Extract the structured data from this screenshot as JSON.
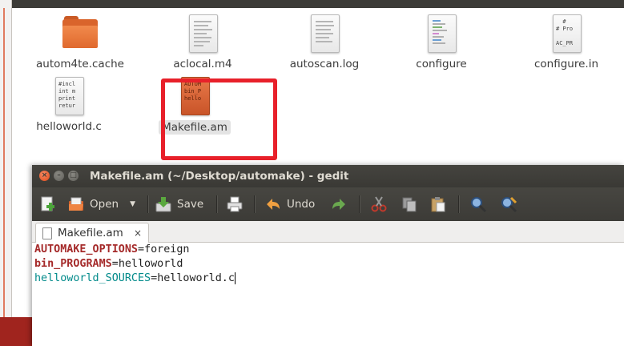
{
  "files": [
    {
      "name": "autom4te.cache",
      "icon": "folder-icon"
    },
    {
      "name": "aclocal.m4",
      "icon": "text-file-icon"
    },
    {
      "name": "autoscan.log",
      "icon": "text-file-icon"
    },
    {
      "name": "configure",
      "icon": "script-file-icon",
      "preview": "",
      "selected": false
    },
    {
      "name": "configure.in",
      "icon": "text-file-icon",
      "preview": "#\n# Pro\n\nAC_PR"
    },
    {
      "name": "helloworld.c",
      "icon": "c-source-icon",
      "preview": "#incl\nint m\nprint\nretur"
    },
    {
      "name": "Makefile.am",
      "icon": "makefile-icon",
      "preview": "AUTOM\nbin_P\nhello",
      "selected": true
    }
  ],
  "window": {
    "title": "Makefile.am (~/Desktop/automake) - gedit"
  },
  "toolbar": {
    "open_label": "Open",
    "save_label": "Save",
    "undo_label": "Undo"
  },
  "tab": {
    "label": "Makefile.am",
    "close": "×"
  },
  "editor": {
    "lines": [
      {
        "key": "AUTOMAKE_OPTIONS",
        "eq": "=",
        "value": "foreign"
      },
      {
        "key": "bin_PROGRAMS",
        "eq": "=",
        "value": "helloworld"
      },
      {
        "key": "helloworld_SOURCES",
        "eq": "=",
        "value": "helloworld.c"
      }
    ]
  },
  "colors": {
    "highlight": "#e8202a",
    "titlebar": "#3c3b37",
    "close_button": "#df4a1a"
  }
}
